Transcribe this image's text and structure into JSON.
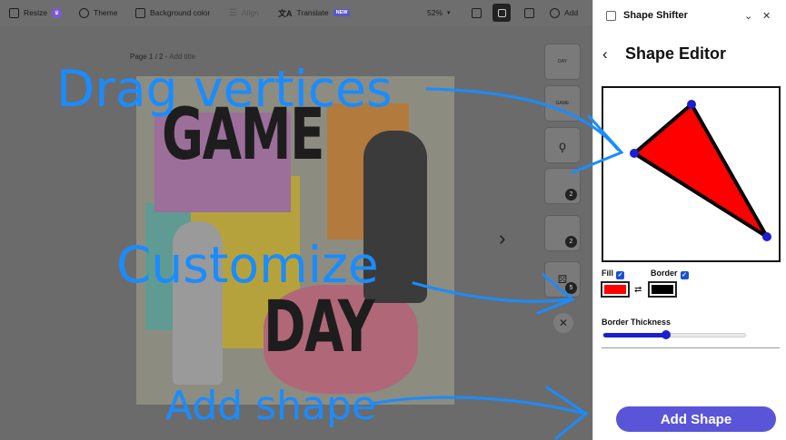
{
  "toolbar": {
    "resize": "Resize",
    "theme": "Theme",
    "background_color": "Background color",
    "align": "Align",
    "translate": "Translate",
    "translate_badge": "NEW",
    "zoom": "52%",
    "add": "Add"
  },
  "canvas": {
    "page_label": "Page 1 / 2",
    "add_title": "- Add title",
    "poster_word_top": "GAME",
    "poster_word_bottom": "DAY",
    "thumbs": [
      {
        "label": "DAY",
        "badge": ""
      },
      {
        "label": "GAME",
        "badge": ""
      },
      {
        "label": "",
        "badge": ""
      },
      {
        "label": "",
        "badge": "2"
      },
      {
        "label": "",
        "badge": "2"
      },
      {
        "label": "",
        "badge": "5"
      }
    ],
    "close_glyph": "✕",
    "next_glyph": "›"
  },
  "annotations": {
    "drag": "Drag vertices",
    "customize": "Customize",
    "add_shape": "Add shape",
    "color": "#1a8cff"
  },
  "panel": {
    "app_name": "Shape Shifter",
    "editor_title": "Shape Editor",
    "fill_label": "Fill",
    "border_label": "Border",
    "fill_color": "#ff0000",
    "border_color": "#000000",
    "border_thickness_label": "Border Thickness",
    "border_thickness_fraction": 0.44,
    "add_shape_button": "Add Shape",
    "accent": "#5a55d8"
  }
}
